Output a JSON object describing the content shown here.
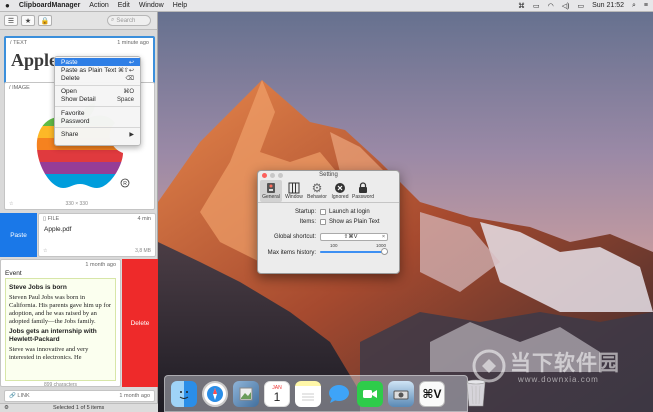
{
  "menubar": {
    "app_name": "ClipboardManager",
    "menus": [
      "Action",
      "Edit",
      "Window",
      "Help"
    ],
    "clock": "Sun 21:52"
  },
  "panel": {
    "search_placeholder": "Search",
    "cards": {
      "text": {
        "type_label": "TEXT",
        "time": "1 minute ago",
        "preview": "Apple"
      },
      "image": {
        "type_label": "IMAGE",
        "dimensions": "330 × 330"
      },
      "file": {
        "type_label": "FILE",
        "time": "4 min",
        "name": "Apple.pdf",
        "size": "3,8 MB"
      },
      "rtf": {
        "time": "1 month ago",
        "heading": "Event",
        "title1": "Steve Jobs is born",
        "body1": "Steven Paul Jobs was born in California. His parents gave him up for adoption, and he was raised by an adopted family—the Jobs family.",
        "title2": "Jobs gets an internship with Hewlett-Packard",
        "body2": "Steve was innovative and very interested in electronics. He",
        "char_count": "899 characters"
      },
      "link": {
        "type_label": "LINK",
        "time": "1 month ago"
      }
    },
    "paste_action": "Paste",
    "delete_action": "Delete",
    "status": "Selected 1 of 5 items"
  },
  "context_menu": {
    "items": [
      {
        "label": "Paste",
        "shortcut": "↩"
      },
      {
        "label": "Paste as Plain Text",
        "shortcut": "⌘⇧↩"
      },
      {
        "label": "Delete",
        "shortcut": "⌫"
      },
      {
        "label": "Open",
        "shortcut": "⌘O"
      },
      {
        "label": "Show Detail",
        "shortcut": "Space"
      },
      {
        "label": "Favorite",
        "shortcut": ""
      },
      {
        "label": "Password",
        "shortcut": ""
      },
      {
        "label": "Share",
        "shortcut": "▶"
      }
    ]
  },
  "settings": {
    "title": "Setting",
    "tabs": [
      "General",
      "Window",
      "Behavior",
      "Ignored",
      "Password"
    ],
    "startup_label": "Startup:",
    "startup_option": "Launch at login",
    "items_label": "Items:",
    "items_option": "Show as Plain Text",
    "shortcut_label": "Global shortcut:",
    "shortcut_value": "⇧⌘V",
    "max_label": "Max items history:",
    "slider_min": "100",
    "slider_max": "1000",
    "slider_value": 1000
  },
  "dock": {
    "calendar_month": "JAN",
    "calendar_day": "1"
  },
  "watermark": {
    "text": "当下软件园",
    "url": "www.downxia.com"
  },
  "colors": {
    "accent": "#2f7fe6",
    "paste": "#1a78e8",
    "delete": "#ee2a2a",
    "selection_border": "#3b8fdb"
  }
}
